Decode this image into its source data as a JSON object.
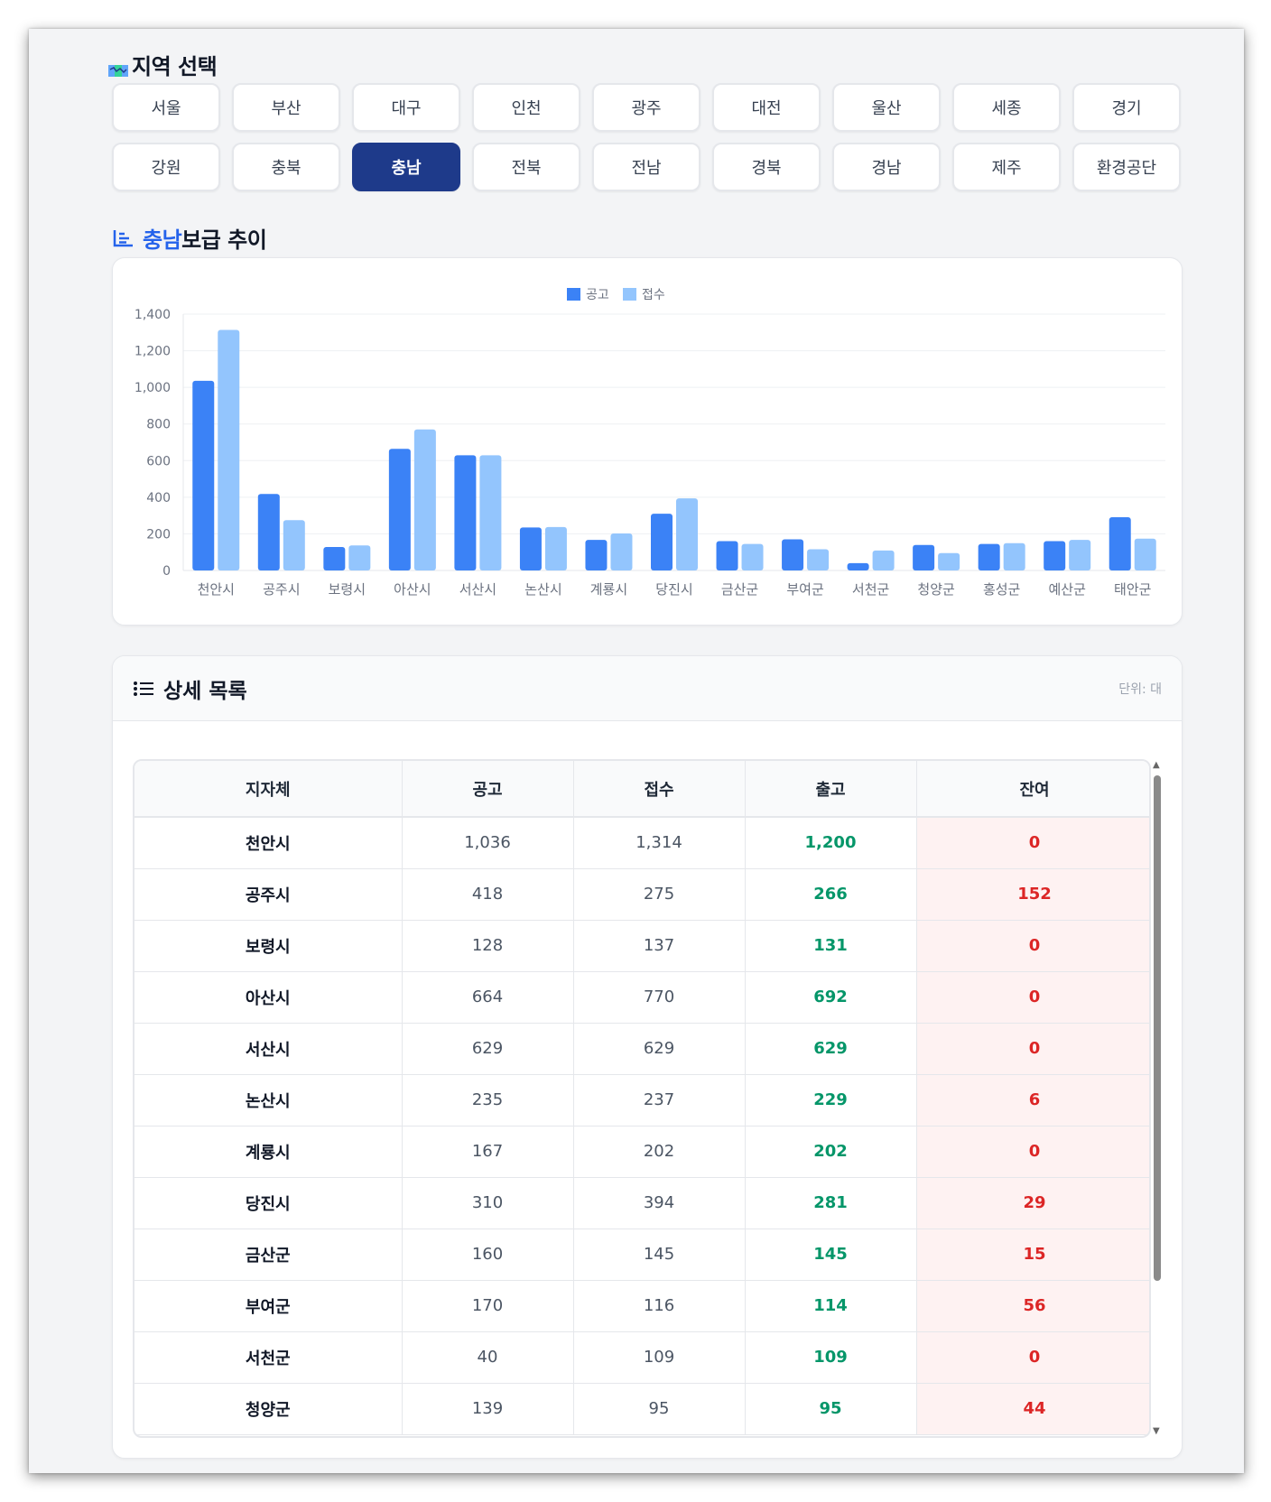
{
  "region_section": {
    "title": "지역 선택",
    "regions": [
      "서울",
      "부산",
      "대구",
      "인천",
      "광주",
      "대전",
      "울산",
      "세종",
      "경기",
      "강원",
      "충북",
      "충남",
      "전북",
      "전남",
      "경북",
      "경남",
      "제주",
      "환경공단"
    ],
    "active": "충남"
  },
  "trend": {
    "title_highlight": "충남",
    "title_rest": "보급 추이"
  },
  "chart_data": {
    "type": "bar",
    "title": "",
    "categories": [
      "천안시",
      "공주시",
      "보령시",
      "아산시",
      "서산시",
      "논산시",
      "계룡시",
      "당진시",
      "금산군",
      "부여군",
      "서천군",
      "청양군",
      "홍성군",
      "예산군",
      "태안군"
    ],
    "series": [
      {
        "name": "공고",
        "color": "#3b82f6",
        "values": [
          1036,
          418,
          128,
          664,
          629,
          235,
          167,
          310,
          160,
          170,
          40,
          139,
          145,
          160,
          291
        ]
      },
      {
        "name": "접수",
        "color": "#93c5fd",
        "values": [
          1314,
          275,
          137,
          770,
          629,
          237,
          202,
          394,
          145,
          116,
          109,
          95,
          149,
          167,
          174
        ]
      }
    ],
    "ylim": [
      0,
      1400
    ],
    "yticks": [
      0,
      200,
      400,
      600,
      800,
      1000,
      1200,
      1400
    ],
    "ytick_labels": [
      "0",
      "200",
      "400",
      "600",
      "800",
      "1,000",
      "1,200",
      "1,400"
    ],
    "legend_position": "top-center",
    "grid": true
  },
  "detail": {
    "title": "상세 목록",
    "unit": "단위: 대",
    "columns": [
      "지자체",
      "공고",
      "접수",
      "출고",
      "잔여"
    ],
    "rows": [
      [
        "천안시",
        "1,036",
        "1,314",
        "1,200",
        "0"
      ],
      [
        "공주시",
        "418",
        "275",
        "266",
        "152"
      ],
      [
        "보령시",
        "128",
        "137",
        "131",
        "0"
      ],
      [
        "아산시",
        "664",
        "770",
        "692",
        "0"
      ],
      [
        "서산시",
        "629",
        "629",
        "629",
        "0"
      ],
      [
        "논산시",
        "235",
        "237",
        "229",
        "6"
      ],
      [
        "계룡시",
        "167",
        "202",
        "202",
        "0"
      ],
      [
        "당진시",
        "310",
        "394",
        "281",
        "29"
      ],
      [
        "금산군",
        "160",
        "145",
        "145",
        "15"
      ],
      [
        "부여군",
        "170",
        "116",
        "114",
        "56"
      ],
      [
        "서천군",
        "40",
        "109",
        "109",
        "0"
      ],
      [
        "청양군",
        "139",
        "95",
        "95",
        "44"
      ]
    ]
  }
}
